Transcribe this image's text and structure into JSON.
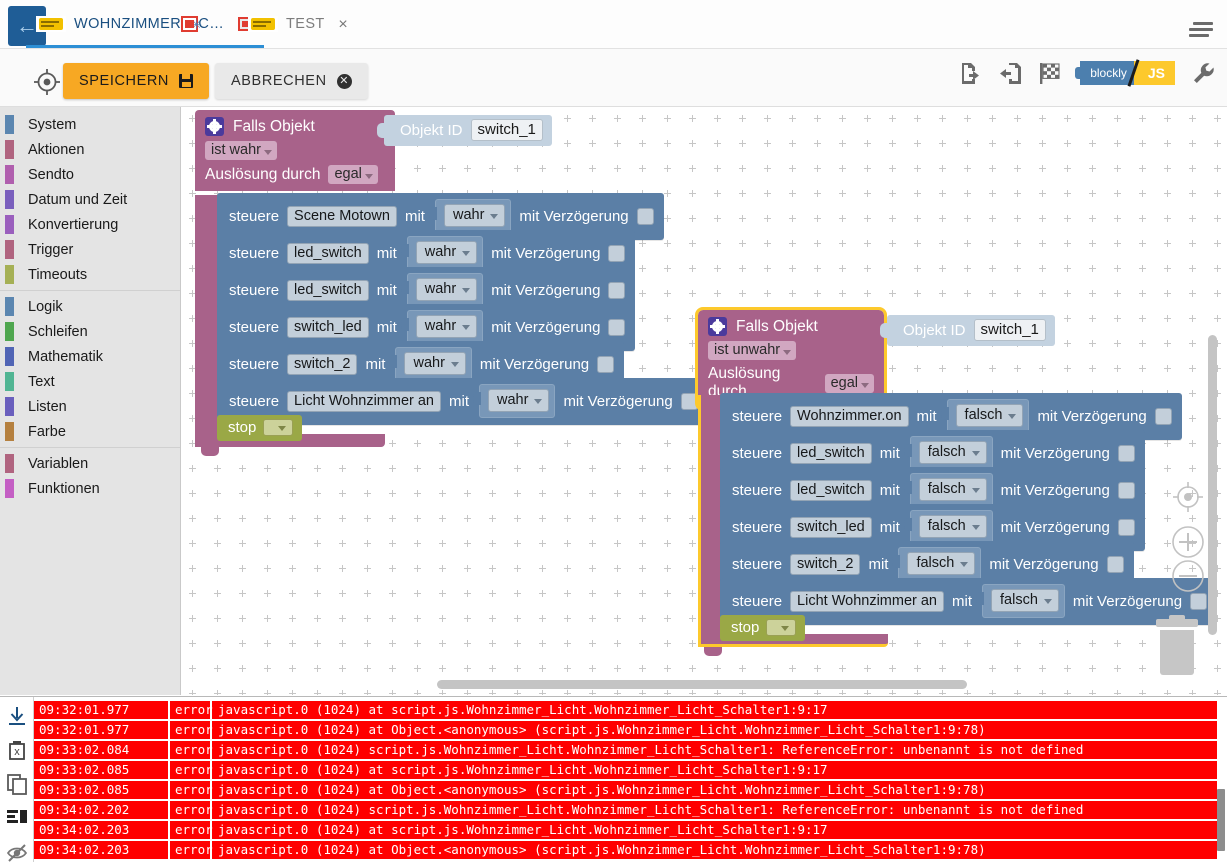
{
  "window": {
    "tabs": [
      {
        "label": "WOHNZIMMER LIC…",
        "icon": "blockly-logo-icon",
        "active": true,
        "error_badge": true
      },
      {
        "label": "TEST",
        "icon": "blockly-logo-icon",
        "active": false,
        "closable": true
      }
    ],
    "back_icon": "arrow-left-icon",
    "menu_icon": "hamburger-menu-icon",
    "close_glyph": "×"
  },
  "toolbar": {
    "center_icon": "crosshair-target-icon",
    "save_label": "SPEICHERN",
    "save_icon": "floppy-disk-icon",
    "cancel_label": "ABBRECHEN",
    "cancel_icon": "close-circle-icon",
    "right_icons": [
      {
        "name": "export-file-icon"
      },
      {
        "name": "import-file-icon"
      },
      {
        "name": "checkered-flag-icon"
      },
      {
        "name": "wrench-icon"
      }
    ],
    "toggle": {
      "left_label": "blockly",
      "right_label": "JS",
      "left_color": "#4c7fae",
      "right_color": "#fdc92c"
    }
  },
  "sidebar": {
    "groups": [
      {
        "items": [
          {
            "label": "System",
            "color": "#5b86b0"
          },
          {
            "label": "Aktionen",
            "color": "#b0647f"
          },
          {
            "label": "Sendto",
            "color": "#b05fae"
          },
          {
            "label": "Datum und Zeit",
            "color": "#7a5fbd"
          },
          {
            "label": "Konvertierung",
            "color": "#9a5fbd"
          },
          {
            "label": "Trigger",
            "color": "#b0647f"
          },
          {
            "label": "Timeouts",
            "color": "#a5b055"
          }
        ]
      },
      {
        "items": [
          {
            "label": "Logik",
            "color": "#5b86b0"
          },
          {
            "label": "Schleifen",
            "color": "#4fa64f"
          },
          {
            "label": "Mathematik",
            "color": "#5165b5"
          },
          {
            "label": "Text",
            "color": "#51b593"
          },
          {
            "label": "Listen",
            "color": "#6a5fbd"
          },
          {
            "label": "Farbe",
            "color": "#b5803f"
          }
        ]
      },
      {
        "items": [
          {
            "label": "Variablen",
            "color": "#b0647f"
          },
          {
            "label": "Funktionen",
            "color": "#c45fc4"
          }
        ]
      }
    ]
  },
  "workspace": {
    "colors": {
      "if_block": "#a8628a",
      "control_block": "#5b7fa6",
      "stop_block": "#9aa846",
      "objid_block": "#c3d2e0",
      "selection": "#fdc92c"
    },
    "blocks": [
      {
        "id": "block-1",
        "selected": false,
        "title": "Falls Objekt",
        "gear_icon": "gear-icon",
        "objid_label": "Objekt ID",
        "objid_value": "switch_1",
        "condition": "ist wahr",
        "trigger_label": "Auslösung durch",
        "trigger_value": "egal",
        "stop_label": "stop",
        "statements": [
          {
            "verb": "steuere",
            "target": "Scene Motown",
            "with": "mit",
            "value": "wahr",
            "delay_label": "mit Verzögerung",
            "delay_checked": false
          },
          {
            "verb": "steuere",
            "target": "led_switch",
            "with": "mit",
            "value": "wahr",
            "delay_label": "mit Verzögerung",
            "delay_checked": false
          },
          {
            "verb": "steuere",
            "target": "led_switch",
            "with": "mit",
            "value": "wahr",
            "delay_label": "mit Verzögerung",
            "delay_checked": false
          },
          {
            "verb": "steuere",
            "target": "switch_led",
            "with": "mit",
            "value": "wahr",
            "delay_label": "mit Verzögerung",
            "delay_checked": false
          },
          {
            "verb": "steuere",
            "target": "switch_2",
            "with": "mit",
            "value": "wahr",
            "delay_label": "mit Verzögerung",
            "delay_checked": false
          },
          {
            "verb": "steuere",
            "target": "Licht Wohnzimmer an",
            "with": "mit",
            "value": "wahr",
            "delay_label": "mit Verzögerung",
            "delay_checked": false
          }
        ]
      },
      {
        "id": "block-2",
        "selected": true,
        "title": "Falls Objekt",
        "gear_icon": "gear-icon",
        "objid_label": "Objekt ID",
        "objid_value": "switch_1",
        "condition": "ist unwahr",
        "trigger_label": "Auslösung durch",
        "trigger_value": "egal",
        "stop_label": "stop",
        "statements": [
          {
            "verb": "steuere",
            "target": "Wohnzimmer.on",
            "with": "mit",
            "value": "falsch",
            "delay_label": "mit Verzögerung",
            "delay_checked": false
          },
          {
            "verb": "steuere",
            "target": "led_switch",
            "with": "mit",
            "value": "falsch",
            "delay_label": "mit Verzögerung",
            "delay_checked": false
          },
          {
            "verb": "steuere",
            "target": "led_switch",
            "with": "mit",
            "value": "falsch",
            "delay_label": "mit Verzögerung",
            "delay_checked": false
          },
          {
            "verb": "steuere",
            "target": "switch_led",
            "with": "mit",
            "value": "falsch",
            "delay_label": "mit Verzögerung",
            "delay_checked": false
          },
          {
            "verb": "steuere",
            "target": "switch_2",
            "with": "mit",
            "value": "falsch",
            "delay_label": "mit Verzögerung",
            "delay_checked": false
          },
          {
            "verb": "steuere",
            "target": "Licht Wohnzimmer an",
            "with": "mit",
            "value": "falsch",
            "delay_label": "mit Verzögerung",
            "delay_checked": false
          }
        ]
      }
    ],
    "controls": [
      {
        "name": "center-workspace-icon"
      },
      {
        "name": "zoom-in-icon"
      },
      {
        "name": "zoom-out-icon"
      },
      {
        "name": "trash-icon"
      }
    ]
  },
  "log": {
    "sidebar_icons": [
      {
        "name": "download-icon"
      },
      {
        "name": "delete-icon"
      },
      {
        "name": "copy-icon"
      },
      {
        "name": "list-view-icon"
      },
      {
        "name": "eye-off-icon"
      }
    ],
    "severity_color": "#ff0000",
    "rows": [
      {
        "time": "09:32:01.977",
        "severity": "error",
        "message": "javascript.0 (1024) at script.js.Wohnzimmer_Licht.Wohnzimmer_Licht_Schalter1:9:17"
      },
      {
        "time": "09:32:01.977",
        "severity": "error",
        "message": "javascript.0 (1024) at Object.<anonymous> (script.js.Wohnzimmer_Licht.Wohnzimmer_Licht_Schalter1:9:78)"
      },
      {
        "time": "09:33:02.084",
        "severity": "error",
        "message": "javascript.0 (1024) script.js.Wohnzimmer_Licht.Wohnzimmer_Licht_Schalter1: ReferenceError: unbenannt is not defined"
      },
      {
        "time": "09:33:02.085",
        "severity": "error",
        "message": "javascript.0 (1024) at script.js.Wohnzimmer_Licht.Wohnzimmer_Licht_Schalter1:9:17"
      },
      {
        "time": "09:33:02.085",
        "severity": "error",
        "message": "javascript.0 (1024) at Object.<anonymous> (script.js.Wohnzimmer_Licht.Wohnzimmer_Licht_Schalter1:9:78)"
      },
      {
        "time": "09:34:02.202",
        "severity": "error",
        "message": "javascript.0 (1024) script.js.Wohnzimmer_Licht.Wohnzimmer_Licht_Schalter1: ReferenceError: unbenannt is not defined"
      },
      {
        "time": "09:34:02.203",
        "severity": "error",
        "message": "javascript.0 (1024) at script.js.Wohnzimmer_Licht.Wohnzimmer_Licht_Schalter1:9:17"
      },
      {
        "time": "09:34:02.203",
        "severity": "error",
        "message": "javascript.0 (1024) at Object.<anonymous> (script.js.Wohnzimmer_Licht.Wohnzimmer_Licht_Schalter1:9:78)"
      }
    ]
  }
}
